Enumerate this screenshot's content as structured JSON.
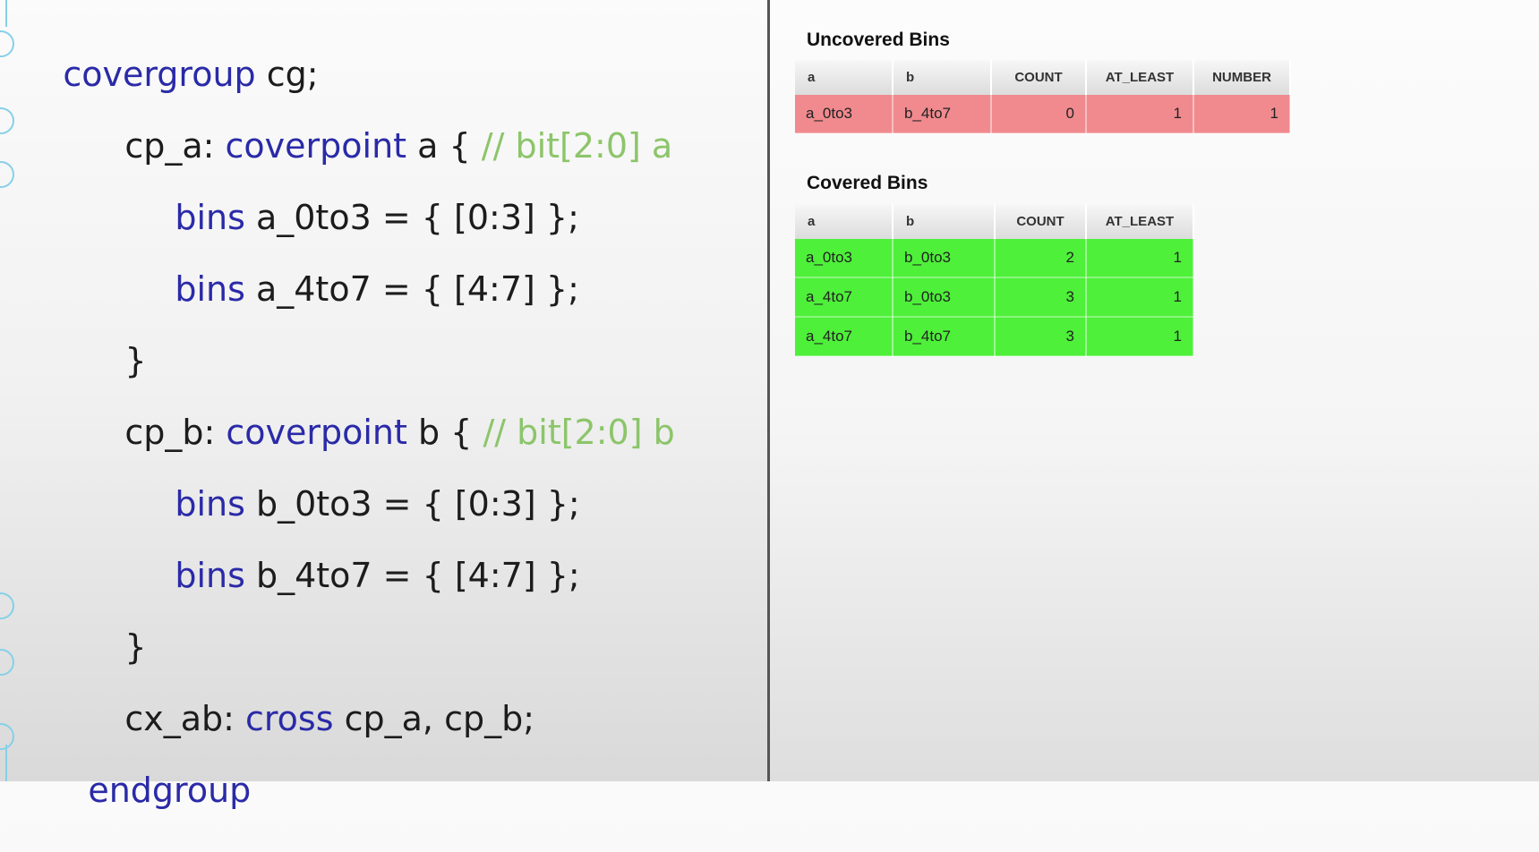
{
  "code": {
    "line1": {
      "kw": "covergroup",
      "rest": " cg;"
    },
    "line2": {
      "pre": "cp_a: ",
      "kw": "coverpoint",
      "mid": " a { ",
      "comment": "// bit[2:0] a"
    },
    "line3": {
      "kw": "bins",
      "rest": " a_0to3 = { [0:3] };"
    },
    "line4": {
      "kw": "bins",
      "rest": " a_4to7 = { [4:7] };"
    },
    "line5": {
      "text": "}"
    },
    "line6": {
      "pre": "cp_b: ",
      "kw": "coverpoint",
      "mid": " b { ",
      "comment": "// bit[2:0] b"
    },
    "line7": {
      "kw": "bins",
      "rest": " b_0to3 = { [0:3] };"
    },
    "line8": {
      "kw": "bins",
      "rest": " b_4to7 = { [4:7] };"
    },
    "line9": {
      "text": "}"
    },
    "line10": {
      "pre": "cx_ab: ",
      "kw": "cross",
      "rest": " cp_a, cp_b;"
    },
    "line11": {
      "kw": "endgroup"
    }
  },
  "report": {
    "uncovered": {
      "title": "Uncovered Bins",
      "headers": [
        "a",
        "b",
        "COUNT",
        "AT_LEAST",
        "NUMBER"
      ],
      "rows": [
        [
          "a_0to3",
          "b_4to7",
          "0",
          "1",
          "1"
        ]
      ],
      "color": "#f08a8e"
    },
    "covered": {
      "title": "Covered Bins",
      "headers": [
        "a",
        "b",
        "COUNT",
        "AT_LEAST"
      ],
      "rows": [
        [
          "a_0to3",
          "b_0to3",
          "2",
          "1"
        ],
        [
          "a_4to7",
          "b_0to3",
          "3",
          "1"
        ],
        [
          "a_4to7",
          "b_4to7",
          "3",
          "1"
        ]
      ],
      "color": "#4ef03a"
    }
  }
}
